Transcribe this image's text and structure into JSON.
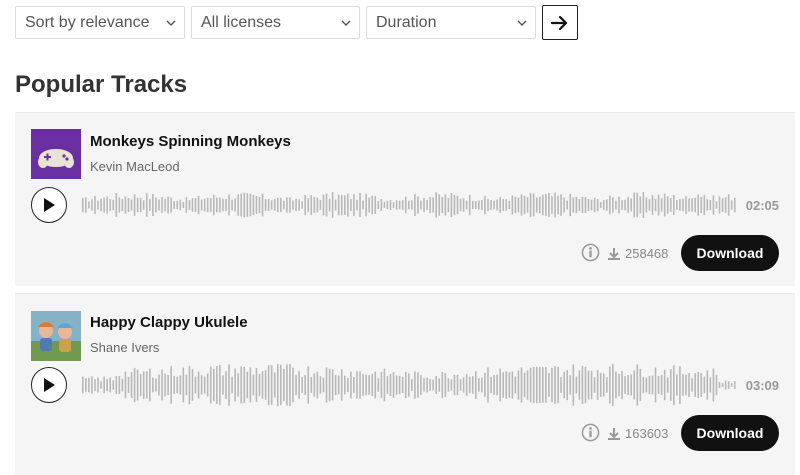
{
  "filters": {
    "sort": "Sort by relevance",
    "license": "All licenses",
    "duration": "Duration"
  },
  "section_title": "Popular Tracks",
  "tracks": [
    {
      "title": "Monkeys Spinning Monkeys",
      "artist": "Kevin MacLeod",
      "duration": "02:05",
      "downloads": "258468",
      "download_label": "Download",
      "thumb_color": "#6a2fa0"
    },
    {
      "title": "Happy Clappy Ukulele",
      "artist": "Shane Ivers",
      "duration": "03:09",
      "downloads": "163603",
      "download_label": "Download",
      "thumb_color": "#7fa96a"
    }
  ]
}
